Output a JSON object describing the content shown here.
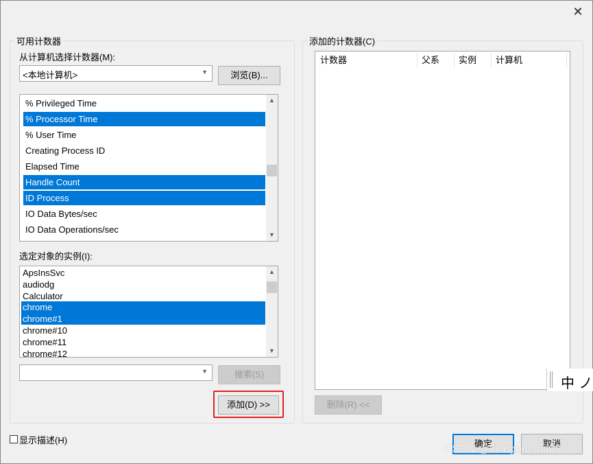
{
  "window": {
    "close_glyph": "✕"
  },
  "available_group": {
    "legend": "可用计数器",
    "from_computer_label": "从计算机选择计数器(M):",
    "computer_value": "<本地计算机>",
    "browse_label": "浏览(B)...",
    "counters": [
      {
        "label": "% Privileged Time",
        "selected": false
      },
      {
        "label": "% Processor Time",
        "selected": true
      },
      {
        "label": "% User Time",
        "selected": false
      },
      {
        "label": "Creating Process ID",
        "selected": false
      },
      {
        "label": "Elapsed Time",
        "selected": false
      },
      {
        "label": "Handle Count",
        "selected": true
      },
      {
        "label": "ID Process",
        "selected": true
      },
      {
        "label": "IO Data Bytes/sec",
        "selected": false
      },
      {
        "label": "IO Data Operations/sec",
        "selected": false
      }
    ],
    "instances_label": "选定对象的实例(I):",
    "instances": [
      {
        "label": "ApsInsSvc",
        "selected": false
      },
      {
        "label": "audiodg",
        "selected": false
      },
      {
        "label": "Calculator",
        "selected": false
      },
      {
        "label": "chrome",
        "selected": true
      },
      {
        "label": "chrome#1",
        "selected": true
      },
      {
        "label": "chrome#10",
        "selected": false
      },
      {
        "label": "chrome#11",
        "selected": false
      },
      {
        "label": "chrome#12",
        "selected": false
      }
    ],
    "search_value": "",
    "search_label": "搜索(S)",
    "add_label": "添加(D) >>"
  },
  "added_group": {
    "legend": "添加的计数器(C)",
    "columns": [
      "计数器",
      "父系",
      "实例",
      "计算机"
    ],
    "delete_label": "删除(R) <<"
  },
  "footer": {
    "show_description_label": "显示描述(H)",
    "show_description_checked": false,
    "ok_label": "确定",
    "cancel_label": "取消"
  },
  "ime": {
    "text": "中 ノ"
  },
  "watermark": "CSDN @xiongpursuit88",
  "colors": {
    "selection": "#0078d7",
    "highlight_box": "#e02020"
  }
}
